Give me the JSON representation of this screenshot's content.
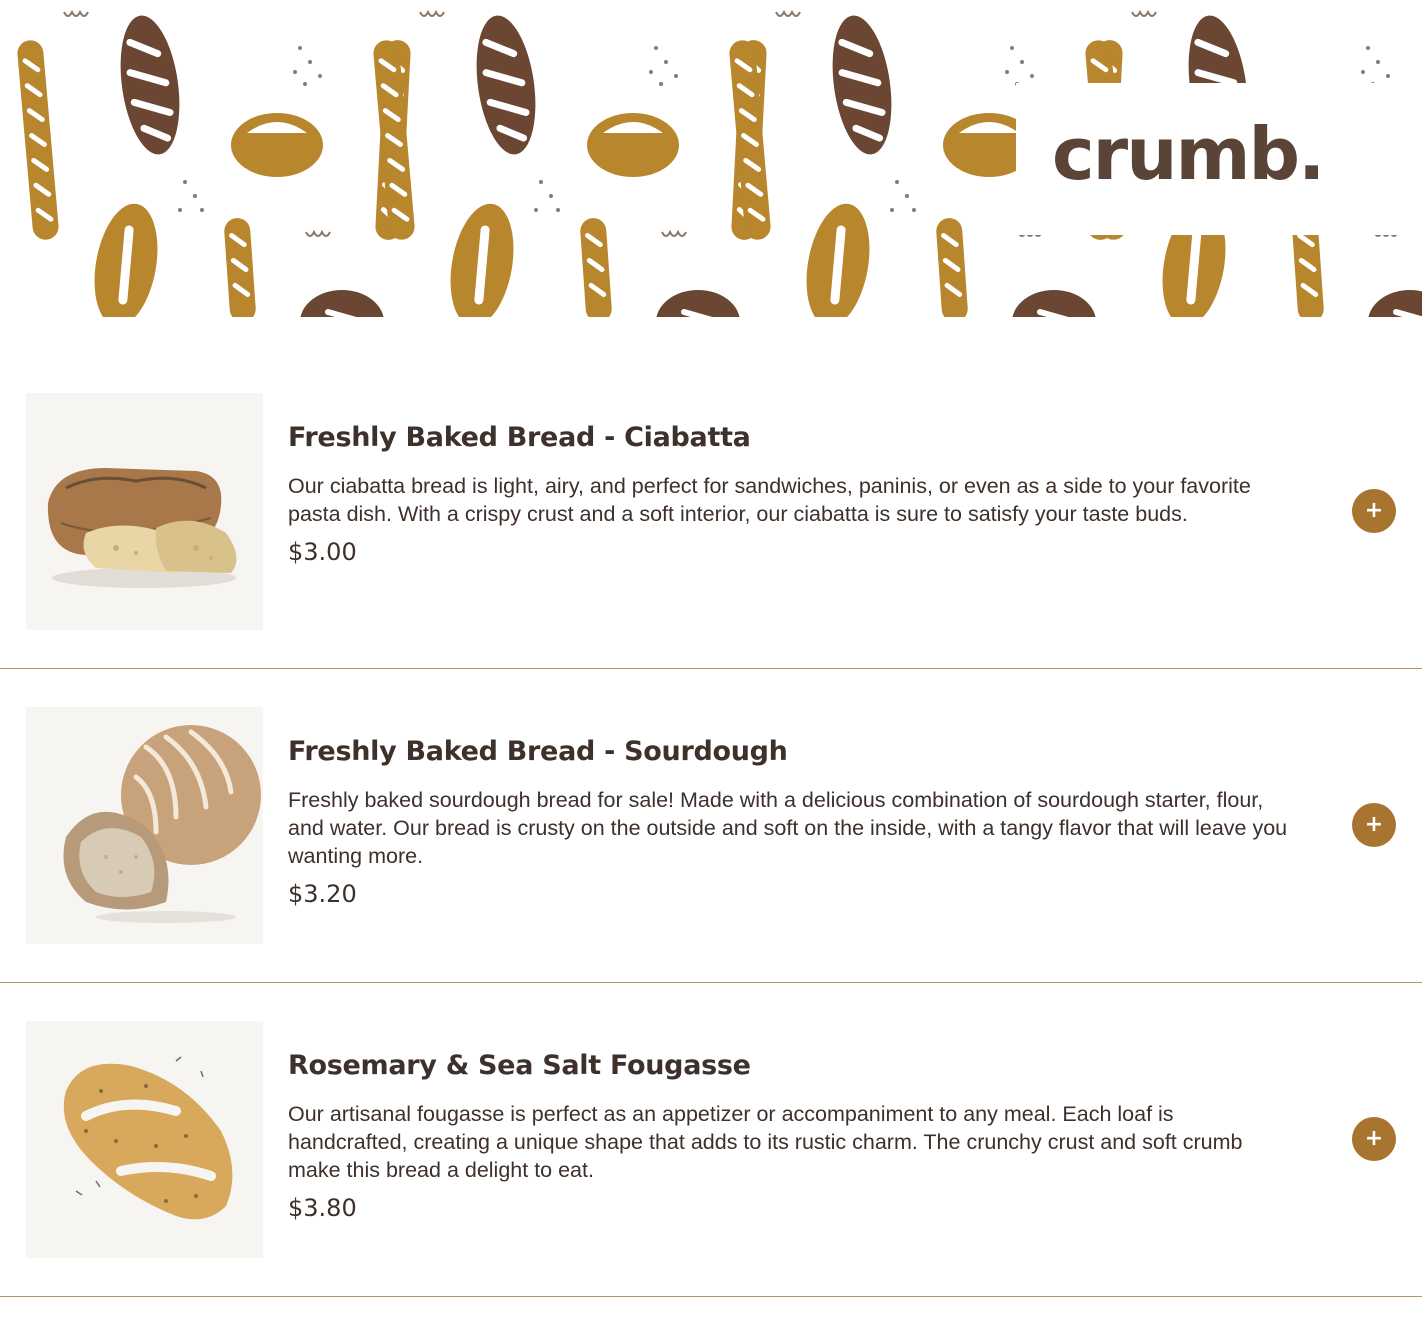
{
  "brand": {
    "logo_text": "crumb."
  },
  "colors": {
    "accent": "#a87530",
    "text": "#3e302a",
    "divider": "#b39667",
    "bread_light": "#b7862d",
    "bread_dark": "#6b4632"
  },
  "menu": {
    "items": [
      {
        "title": "Freshly Baked Bread - Ciabatta",
        "description": "Our ciabatta bread is light, airy, and perfect for sandwiches, paninis, or even as a side to your favorite pasta dish. With a crispy crust and a soft interior, our ciabatta is sure to satisfy your taste buds.",
        "price": "$3.00",
        "add_label": "+",
        "image_icon": "ciabatta-image"
      },
      {
        "title": "Freshly Baked Bread - Sourdough",
        "description": "Freshly baked sourdough bread for sale! Made with a delicious combination of sourdough starter, flour, and water. Our bread is crusty on the outside and soft on the inside, with a tangy flavor that will leave you wanting more.",
        "price": "$3.20",
        "add_label": "+",
        "image_icon": "sourdough-image"
      },
      {
        "title": "Rosemary & Sea Salt Fougasse",
        "description": "Our artisanal fougasse is perfect as an appetizer or accompaniment to any meal. Each loaf is handcrafted, creating a unique shape that adds to its rustic charm. The crunchy crust and soft crumb make this bread a delight to eat.",
        "price": "$3.80",
        "add_label": "+",
        "image_icon": "fougasse-image"
      }
    ]
  }
}
